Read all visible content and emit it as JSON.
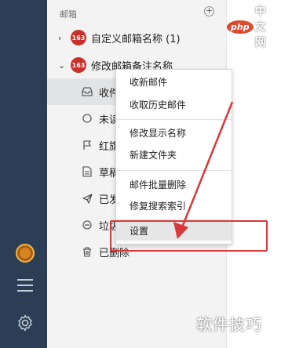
{
  "watermark_logo": {
    "php": "php",
    "site": "中文网"
  },
  "panel": {
    "header": "邮箱",
    "add_glyph": "+",
    "accounts": [
      {
        "chevron": "›",
        "badge": "163",
        "name": "自定义邮箱名称 (1)"
      },
      {
        "chevron": "⌄",
        "badge": "163",
        "name": "修改邮箱备注名称"
      }
    ],
    "folders": [
      {
        "icon": "inbox-icon",
        "label": "收件箱"
      },
      {
        "icon": "unread-icon",
        "label": "未读邮件"
      },
      {
        "icon": "flag-icon",
        "label": "红旗邮件"
      },
      {
        "icon": "draft-icon",
        "label": "草稿箱"
      },
      {
        "icon": "sent-icon",
        "label": "已发送"
      },
      {
        "icon": "spam-icon",
        "label": "垃圾邮件"
      },
      {
        "icon": "trash-icon",
        "label": "已删除"
      }
    ]
  },
  "context_menu": {
    "items": [
      "收新邮件",
      "收取历史邮件",
      "修改显示名称",
      "新建文件夹",
      "邮件批量删除",
      "修复搜索索引",
      "设置"
    ]
  },
  "watermark_text": "软件技巧",
  "colors": {
    "rail": "#2c3e55",
    "highlight": "#d8383a",
    "badge": "#c8312a"
  }
}
